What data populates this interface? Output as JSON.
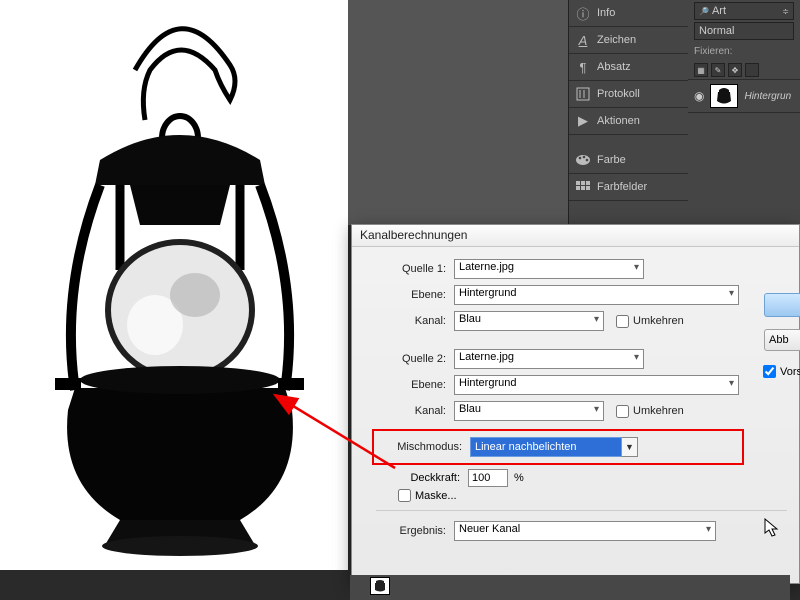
{
  "panels": {
    "info": "Info",
    "zeichen": "Zeichen",
    "absatz": "Absatz",
    "protokoll": "Protokoll",
    "aktionen": "Aktionen",
    "farbe": "Farbe",
    "farbfelder": "Farbfelder"
  },
  "side": {
    "art": "Art",
    "arrow": "≡",
    "normal": "Normal",
    "fix": "Fixieren:",
    "layer": "Hintergrun"
  },
  "dialog": {
    "title": "Kanalberechnungen",
    "quelle1": "Quelle 1:",
    "quelle2": "Quelle 2:",
    "ebene": "Ebene:",
    "kanal": "Kanal:",
    "umkehren": "Umkehren",
    "file": "Laterne.jpg",
    "ebene_val": "Hintergrund",
    "kanal_val": "Blau",
    "misch": "Mischmodus:",
    "misch_val": "Linear nachbelichten",
    "deck": "Deckkraft:",
    "deck_val": "100",
    "pct": "%",
    "maske": "Maske...",
    "ergebnis": "Ergebnis:",
    "ergebnis_val": "Neuer Kanal",
    "abb": "Abb",
    "vors": "Vors"
  }
}
